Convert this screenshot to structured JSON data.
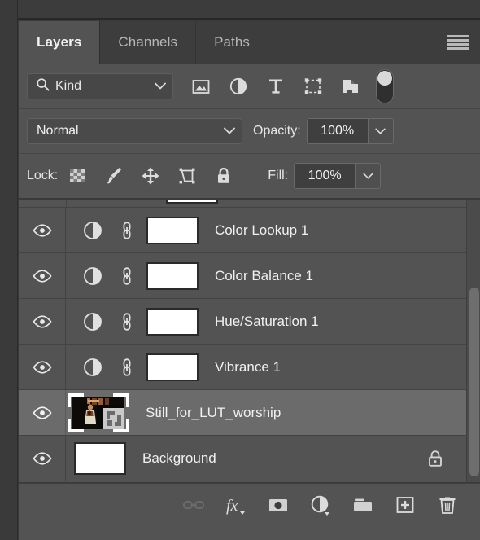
{
  "panel": {
    "tabs": [
      {
        "label": "Layers",
        "active": true
      },
      {
        "label": "Channels",
        "active": false
      },
      {
        "label": "Paths",
        "active": false
      }
    ],
    "menu_icon": "hamburger-menu-icon"
  },
  "filter": {
    "kind_label": "Kind",
    "search_icon": "search-icon",
    "chevron_icon": "chevron-down-icon",
    "icons": [
      {
        "name": "filter-pixel-layers-icon",
        "title": "Pixel layers"
      },
      {
        "name": "filter-adjustment-layers-icon",
        "title": "Adjustment layers"
      },
      {
        "name": "filter-type-layers-icon",
        "title": "Type layers"
      },
      {
        "name": "filter-shape-layers-icon",
        "title": "Shape layers"
      },
      {
        "name": "filter-smart-object-layers-icon",
        "title": "Smart object layers"
      }
    ],
    "toggle": {
      "name": "filter-enable-toggle",
      "state": "off"
    }
  },
  "blend": {
    "mode": "Normal",
    "opacity_label": "Opacity:",
    "opacity_value": "100%"
  },
  "lock": {
    "label": "Lock:",
    "icons": [
      {
        "name": "lock-transparent-pixels-icon"
      },
      {
        "name": "lock-image-pixels-icon"
      },
      {
        "name": "lock-position-icon"
      },
      {
        "name": "lock-artboard-nesting-icon"
      },
      {
        "name": "lock-all-icon"
      }
    ],
    "fill_label": "Fill:",
    "fill_value": "100%"
  },
  "layers": [
    {
      "name": "Color Lookup 1",
      "type": "adjustment",
      "visible": true,
      "selected": false,
      "linked": true,
      "locked": false
    },
    {
      "name": "Color Balance 1",
      "type": "adjustment",
      "visible": true,
      "selected": false,
      "linked": true,
      "locked": false
    },
    {
      "name": "Hue/Saturation 1",
      "type": "adjustment",
      "visible": true,
      "selected": false,
      "linked": true,
      "locked": false
    },
    {
      "name": "Vibrance 1",
      "type": "adjustment",
      "visible": true,
      "selected": false,
      "linked": true,
      "locked": false
    },
    {
      "name": "Still_for_LUT_worship",
      "type": "smart-object",
      "visible": true,
      "selected": true,
      "linked": false,
      "locked": false
    },
    {
      "name": "Background",
      "type": "pixel",
      "visible": true,
      "selected": false,
      "linked": false,
      "locked": true
    }
  ],
  "bottom_toolbar": [
    {
      "name": "link-layers-button",
      "title": "Link layers",
      "enabled": false
    },
    {
      "name": "layer-style-fx-button",
      "title": "Add a layer style",
      "enabled": true
    },
    {
      "name": "add-layer-mask-button",
      "title": "Add layer mask",
      "enabled": true
    },
    {
      "name": "new-adjustment-layer-button",
      "title": "Create new fill or adjustment layer",
      "enabled": true
    },
    {
      "name": "new-group-button",
      "title": "Create a new group",
      "enabled": true
    },
    {
      "name": "new-layer-button",
      "title": "Create a new layer",
      "enabled": true
    },
    {
      "name": "delete-layer-button",
      "title": "Delete layer",
      "enabled": true
    }
  ],
  "colors": {
    "panel_bg": "#535353",
    "tab_inactive_bg": "#3d3d3d",
    "selected_row": "#6b6b6b",
    "text": "#f0f0f0",
    "text_dim": "#b6b6b6"
  }
}
